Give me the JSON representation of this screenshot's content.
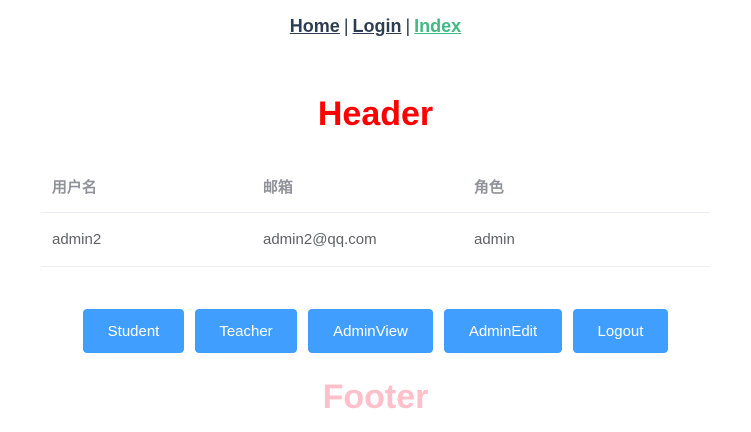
{
  "nav": {
    "home": "Home",
    "sep1": "|",
    "login": "Login",
    "sep2": "|",
    "index": "Index"
  },
  "header": {
    "title": "Header"
  },
  "table": {
    "columns": [
      "用户名",
      "邮箱",
      "角色"
    ],
    "rows": [
      [
        "admin2",
        "admin2@qq.com",
        "admin"
      ]
    ]
  },
  "buttons": {
    "student": "Student",
    "teacher": "Teacher",
    "adminview": "AdminView",
    "adminedit": "AdminEdit",
    "logout": "Logout"
  },
  "footer": {
    "title": "Footer"
  },
  "colors": {
    "header": "#ff0000",
    "footer": "#ffc0cb",
    "button": "#409eff",
    "active_link": "#42b983"
  }
}
